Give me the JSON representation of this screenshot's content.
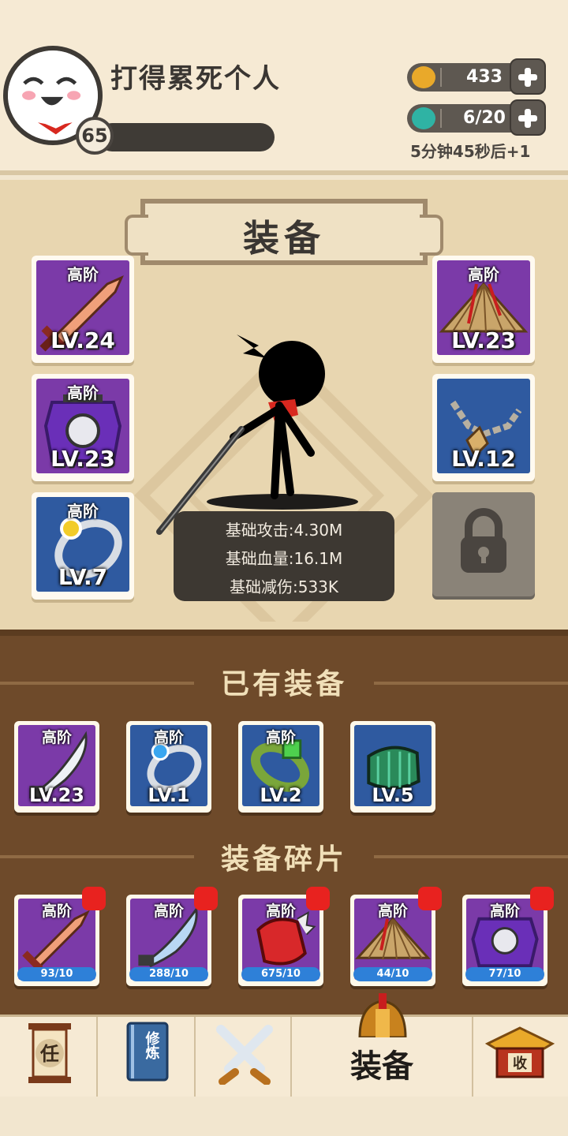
{
  "player": {
    "name": "打得累死个人",
    "level": "65"
  },
  "resources": {
    "coins": "433",
    "energy": "6/20",
    "timer": "5分钟45秒后+1"
  },
  "equip_panel": {
    "title": "装备",
    "slots": [
      {
        "grade": "高阶",
        "level": "LV.24",
        "item": "sword-icon",
        "color": "purple"
      },
      {
        "grade": "高阶",
        "level": "LV.23",
        "item": "armor-icon",
        "color": "purple"
      },
      {
        "grade": "高阶",
        "level": "LV.7",
        "item": "ring-icon",
        "color": "blue"
      },
      {
        "grade": "高阶",
        "level": "LV.23",
        "item": "straw-hat-icon",
        "color": "purple"
      },
      {
        "grade": "",
        "level": "LV.12",
        "item": "necklace-icon",
        "color": "blue"
      }
    ],
    "stats": {
      "attack": "基础攻击:4.30M",
      "hp": "基础血量:16.1M",
      "reduction": "基础减伤:533K"
    }
  },
  "owned": {
    "title": "已有装备",
    "items": [
      {
        "grade": "高阶",
        "level": "LV.23",
        "item": "saber-icon"
      },
      {
        "grade": "高阶",
        "level": "LV.1",
        "item": "ring-icon"
      },
      {
        "grade": "高阶",
        "level": "LV.2",
        "item": "bracelet-icon"
      },
      {
        "grade": "",
        "level": "LV.5",
        "item": "bracer-icon"
      }
    ]
  },
  "fragments": {
    "title": "装备碎片",
    "items": [
      {
        "grade": "高阶",
        "count": "93/10",
        "item": "sword-icon"
      },
      {
        "grade": "高阶",
        "count": "288/10",
        "item": "saber-icon"
      },
      {
        "grade": "高阶",
        "count": "675/10",
        "item": "glove-icon"
      },
      {
        "grade": "高阶",
        "count": "44/10",
        "item": "straw-hat-icon"
      },
      {
        "grade": "高阶",
        "count": "77/10",
        "item": "armor-icon"
      }
    ]
  },
  "nav": {
    "tasks_glyph": "任",
    "train_glyph": "修炼",
    "equip_label": "装备",
    "collect_glyph": "收"
  },
  "colors": {
    "purple": "#7b3aa8",
    "blue": "#2f5aa0",
    "frag_bar": "#2e80d8",
    "badge_red": "#e8221f"
  }
}
